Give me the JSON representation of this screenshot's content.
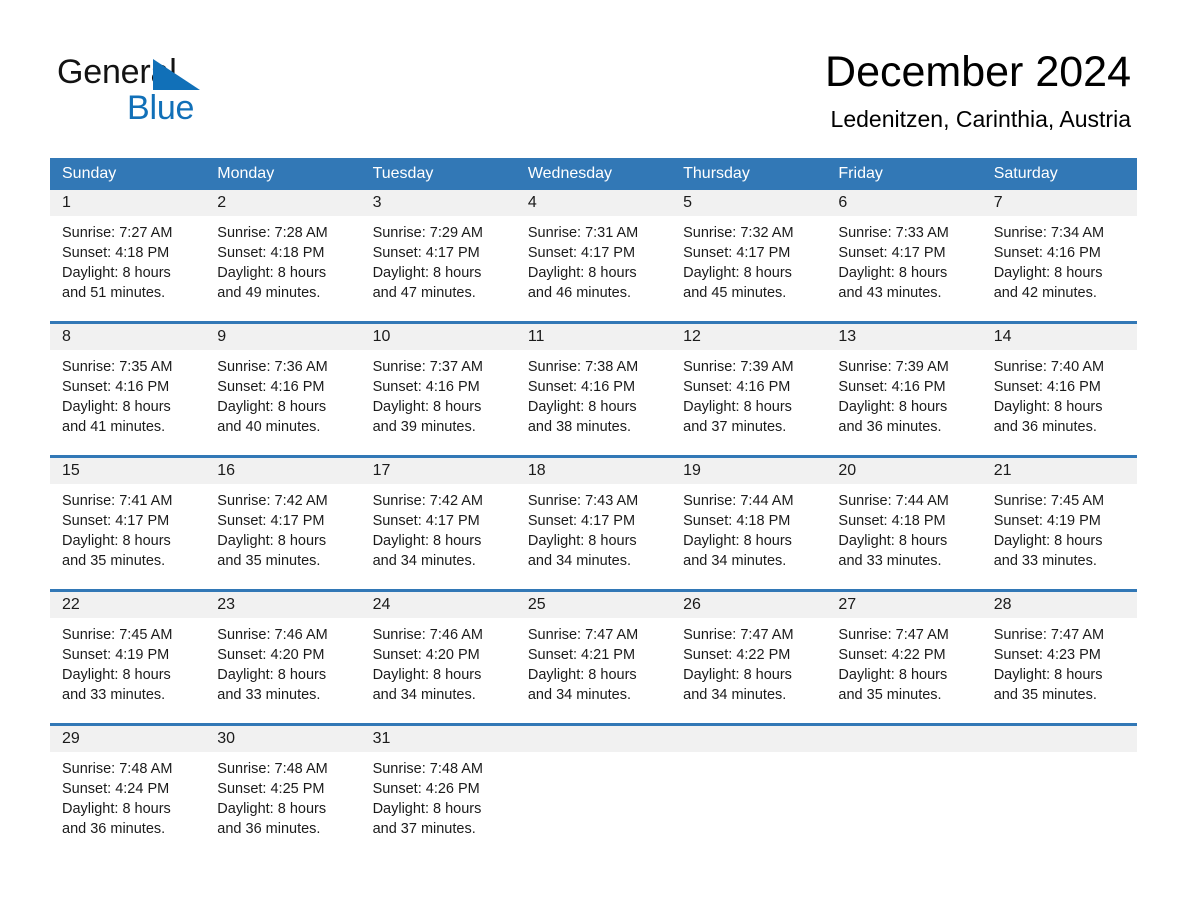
{
  "brand": {
    "name_part1": "General",
    "name_part2": "Blue",
    "accent_color": "#1170b8",
    "logo_icon": "triangle-logo-icon"
  },
  "header": {
    "title": "December 2024",
    "subtitle": "Ledenitzen, Carinthia, Austria"
  },
  "calendar": {
    "header_bg": "#3278b6",
    "weekdays": [
      "Sunday",
      "Monday",
      "Tuesday",
      "Wednesday",
      "Thursday",
      "Friday",
      "Saturday"
    ],
    "weeks": [
      [
        {
          "day": "1",
          "sunrise": "Sunrise: 7:27 AM",
          "sunset": "Sunset: 4:18 PM",
          "daylight_line1": "Daylight: 8 hours",
          "daylight_line2": "and 51 minutes."
        },
        {
          "day": "2",
          "sunrise": "Sunrise: 7:28 AM",
          "sunset": "Sunset: 4:18 PM",
          "daylight_line1": "Daylight: 8 hours",
          "daylight_line2": "and 49 minutes."
        },
        {
          "day": "3",
          "sunrise": "Sunrise: 7:29 AM",
          "sunset": "Sunset: 4:17 PM",
          "daylight_line1": "Daylight: 8 hours",
          "daylight_line2": "and 47 minutes."
        },
        {
          "day": "4",
          "sunrise": "Sunrise: 7:31 AM",
          "sunset": "Sunset: 4:17 PM",
          "daylight_line1": "Daylight: 8 hours",
          "daylight_line2": "and 46 minutes."
        },
        {
          "day": "5",
          "sunrise": "Sunrise: 7:32 AM",
          "sunset": "Sunset: 4:17 PM",
          "daylight_line1": "Daylight: 8 hours",
          "daylight_line2": "and 45 minutes."
        },
        {
          "day": "6",
          "sunrise": "Sunrise: 7:33 AM",
          "sunset": "Sunset: 4:17 PM",
          "daylight_line1": "Daylight: 8 hours",
          "daylight_line2": "and 43 minutes."
        },
        {
          "day": "7",
          "sunrise": "Sunrise: 7:34 AM",
          "sunset": "Sunset: 4:16 PM",
          "daylight_line1": "Daylight: 8 hours",
          "daylight_line2": "and 42 minutes."
        }
      ],
      [
        {
          "day": "8",
          "sunrise": "Sunrise: 7:35 AM",
          "sunset": "Sunset: 4:16 PM",
          "daylight_line1": "Daylight: 8 hours",
          "daylight_line2": "and 41 minutes."
        },
        {
          "day": "9",
          "sunrise": "Sunrise: 7:36 AM",
          "sunset": "Sunset: 4:16 PM",
          "daylight_line1": "Daylight: 8 hours",
          "daylight_line2": "and 40 minutes."
        },
        {
          "day": "10",
          "sunrise": "Sunrise: 7:37 AM",
          "sunset": "Sunset: 4:16 PM",
          "daylight_line1": "Daylight: 8 hours",
          "daylight_line2": "and 39 minutes."
        },
        {
          "day": "11",
          "sunrise": "Sunrise: 7:38 AM",
          "sunset": "Sunset: 4:16 PM",
          "daylight_line1": "Daylight: 8 hours",
          "daylight_line2": "and 38 minutes."
        },
        {
          "day": "12",
          "sunrise": "Sunrise: 7:39 AM",
          "sunset": "Sunset: 4:16 PM",
          "daylight_line1": "Daylight: 8 hours",
          "daylight_line2": "and 37 minutes."
        },
        {
          "day": "13",
          "sunrise": "Sunrise: 7:39 AM",
          "sunset": "Sunset: 4:16 PM",
          "daylight_line1": "Daylight: 8 hours",
          "daylight_line2": "and 36 minutes."
        },
        {
          "day": "14",
          "sunrise": "Sunrise: 7:40 AM",
          "sunset": "Sunset: 4:16 PM",
          "daylight_line1": "Daylight: 8 hours",
          "daylight_line2": "and 36 minutes."
        }
      ],
      [
        {
          "day": "15",
          "sunrise": "Sunrise: 7:41 AM",
          "sunset": "Sunset: 4:17 PM",
          "daylight_line1": "Daylight: 8 hours",
          "daylight_line2": "and 35 minutes."
        },
        {
          "day": "16",
          "sunrise": "Sunrise: 7:42 AM",
          "sunset": "Sunset: 4:17 PM",
          "daylight_line1": "Daylight: 8 hours",
          "daylight_line2": "and 35 minutes."
        },
        {
          "day": "17",
          "sunrise": "Sunrise: 7:42 AM",
          "sunset": "Sunset: 4:17 PM",
          "daylight_line1": "Daylight: 8 hours",
          "daylight_line2": "and 34 minutes."
        },
        {
          "day": "18",
          "sunrise": "Sunrise: 7:43 AM",
          "sunset": "Sunset: 4:17 PM",
          "daylight_line1": "Daylight: 8 hours",
          "daylight_line2": "and 34 minutes."
        },
        {
          "day": "19",
          "sunrise": "Sunrise: 7:44 AM",
          "sunset": "Sunset: 4:18 PM",
          "daylight_line1": "Daylight: 8 hours",
          "daylight_line2": "and 34 minutes."
        },
        {
          "day": "20",
          "sunrise": "Sunrise: 7:44 AM",
          "sunset": "Sunset: 4:18 PM",
          "daylight_line1": "Daylight: 8 hours",
          "daylight_line2": "and 33 minutes."
        },
        {
          "day": "21",
          "sunrise": "Sunrise: 7:45 AM",
          "sunset": "Sunset: 4:19 PM",
          "daylight_line1": "Daylight: 8 hours",
          "daylight_line2": "and 33 minutes."
        }
      ],
      [
        {
          "day": "22",
          "sunrise": "Sunrise: 7:45 AM",
          "sunset": "Sunset: 4:19 PM",
          "daylight_line1": "Daylight: 8 hours",
          "daylight_line2": "and 33 minutes."
        },
        {
          "day": "23",
          "sunrise": "Sunrise: 7:46 AM",
          "sunset": "Sunset: 4:20 PM",
          "daylight_line1": "Daylight: 8 hours",
          "daylight_line2": "and 33 minutes."
        },
        {
          "day": "24",
          "sunrise": "Sunrise: 7:46 AM",
          "sunset": "Sunset: 4:20 PM",
          "daylight_line1": "Daylight: 8 hours",
          "daylight_line2": "and 34 minutes."
        },
        {
          "day": "25",
          "sunrise": "Sunrise: 7:47 AM",
          "sunset": "Sunset: 4:21 PM",
          "daylight_line1": "Daylight: 8 hours",
          "daylight_line2": "and 34 minutes."
        },
        {
          "day": "26",
          "sunrise": "Sunrise: 7:47 AM",
          "sunset": "Sunset: 4:22 PM",
          "daylight_line1": "Daylight: 8 hours",
          "daylight_line2": "and 34 minutes."
        },
        {
          "day": "27",
          "sunrise": "Sunrise: 7:47 AM",
          "sunset": "Sunset: 4:22 PM",
          "daylight_line1": "Daylight: 8 hours",
          "daylight_line2": "and 35 minutes."
        },
        {
          "day": "28",
          "sunrise": "Sunrise: 7:47 AM",
          "sunset": "Sunset: 4:23 PM",
          "daylight_line1": "Daylight: 8 hours",
          "daylight_line2": "and 35 minutes."
        }
      ],
      [
        {
          "day": "29",
          "sunrise": "Sunrise: 7:48 AM",
          "sunset": "Sunset: 4:24 PM",
          "daylight_line1": "Daylight: 8 hours",
          "daylight_line2": "and 36 minutes."
        },
        {
          "day": "30",
          "sunrise": "Sunrise: 7:48 AM",
          "sunset": "Sunset: 4:25 PM",
          "daylight_line1": "Daylight: 8 hours",
          "daylight_line2": "and 36 minutes."
        },
        {
          "day": "31",
          "sunrise": "Sunrise: 7:48 AM",
          "sunset": "Sunset: 4:26 PM",
          "daylight_line1": "Daylight: 8 hours",
          "daylight_line2": "and 37 minutes."
        },
        {
          "day": "",
          "sunrise": "",
          "sunset": "",
          "daylight_line1": "",
          "daylight_line2": ""
        },
        {
          "day": "",
          "sunrise": "",
          "sunset": "",
          "daylight_line1": "",
          "daylight_line2": ""
        },
        {
          "day": "",
          "sunrise": "",
          "sunset": "",
          "daylight_line1": "",
          "daylight_line2": ""
        },
        {
          "day": "",
          "sunrise": "",
          "sunset": "",
          "daylight_line1": "",
          "daylight_line2": ""
        }
      ]
    ]
  }
}
